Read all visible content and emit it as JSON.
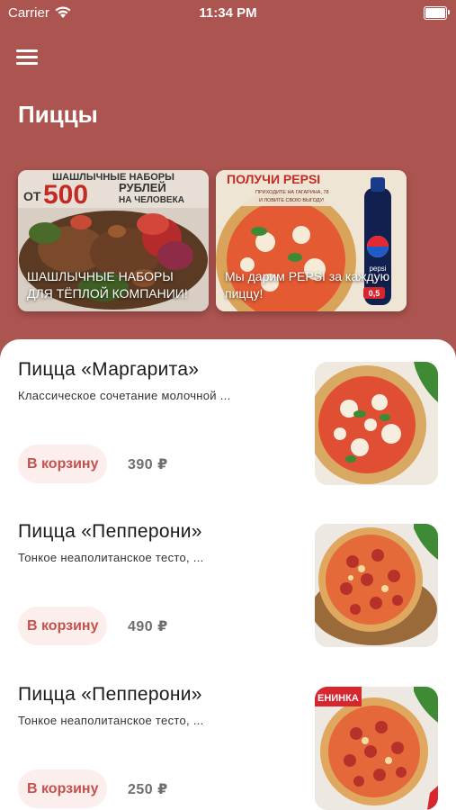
{
  "status_bar": {
    "carrier": "Carrier",
    "time": "11:34 PM"
  },
  "header": {
    "menu_icon": "hamburger-menu-icon",
    "title": "Пиццы"
  },
  "promos": [
    {
      "headline_top": "ШАШЛЫЧНЫЕ НАБОРЫ",
      "headline_from": "ОТ",
      "headline_amount": "500",
      "headline_rub": "РУБЛЕЙ",
      "headline_per": "НА ЧЕЛОВЕКА",
      "caption": "ШАШЛЫЧНЫЕ НАБОРЫ ДЛЯ ТЁПЛОЙ КОМПАНИИ!"
    },
    {
      "headline": "ПОЛУЧИ PEPSI",
      "subline_1": "ПРИХОДИТЕ НА ГАГАРИНА, 78",
      "subline_2": "И ЛОВИТЕ СВОЮ ВЫГОДУ!",
      "bottle_label": "pepsi",
      "bottle_volume": "0,5",
      "caption": "Мы дарим PEPSI за каждую пиццу!"
    }
  ],
  "products": [
    {
      "name": "Пицца «Маргарита»",
      "description": "Классическое сочетание молочной ...",
      "button_label": "В корзину",
      "price": "390 ₽",
      "image": "margherita-pizza"
    },
    {
      "name": "Пицца «Пепперони»",
      "description": "Тонкое неаполитанское тесто, ...",
      "button_label": "В корзину",
      "price": "490 ₽",
      "image": "pepperoni-pizza"
    },
    {
      "name": "Пицца «Пепперони»",
      "description": "Тонкое неаполитанское тесто, ...",
      "button_label": "В корзину",
      "price": "250 ₽",
      "image": "pepperoni-pizza",
      "image_badge": "ЕНИНКА"
    }
  ],
  "colors": {
    "header_background": "#ac5450",
    "accent": "#c4524c",
    "button_background": "#fbeeed",
    "price": "#6e6e6e"
  }
}
